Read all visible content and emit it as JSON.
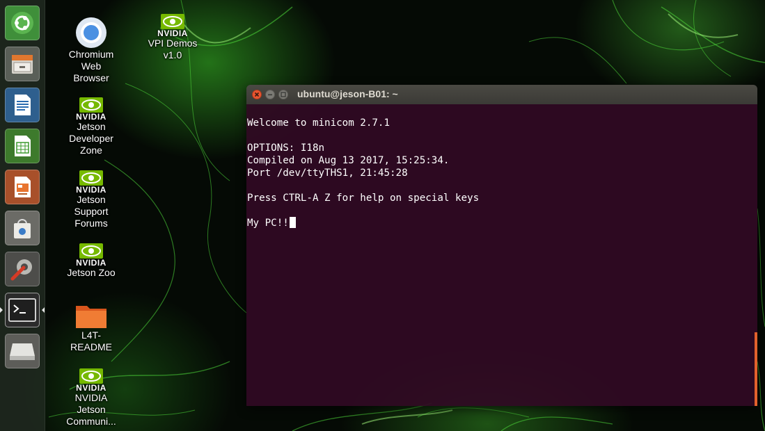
{
  "launcher": {
    "items": [
      {
        "name": "ubuntu-dash",
        "icon": "ubuntu-logo-icon"
      },
      {
        "name": "files",
        "icon": "file-cabinet-icon"
      },
      {
        "name": "libreoffice-writer",
        "icon": "writer-document-icon"
      },
      {
        "name": "libreoffice-calc",
        "icon": "calc-spreadsheet-icon"
      },
      {
        "name": "libreoffice-impress",
        "icon": "impress-presentation-icon"
      },
      {
        "name": "software-center",
        "icon": "shopping-bag-icon"
      },
      {
        "name": "system-settings",
        "icon": "wrench-gear-icon"
      },
      {
        "name": "terminal",
        "icon": "terminal-icon",
        "active": true
      },
      {
        "name": "removable-drive",
        "icon": "drive-icon"
      }
    ]
  },
  "desktop": {
    "chromium": {
      "label_lines": [
        "Chromium",
        "Web",
        "Browser"
      ],
      "icon": "chromium-icon"
    },
    "vpi": {
      "brand": "NVIDIA",
      "label_lines": [
        "VPI Demos",
        "v1.0"
      ],
      "icon": "nvidia-eye-icon"
    },
    "devzone": {
      "brand": "NVIDIA",
      "label_lines": [
        "Jetson",
        "Developer",
        "Zone"
      ],
      "icon": "nvidia-eye-icon"
    },
    "forums": {
      "brand": "NVIDIA",
      "label_lines": [
        "Jetson",
        "Support",
        "Forums"
      ],
      "icon": "nvidia-eye-icon"
    },
    "zoo": {
      "brand": "NVIDIA",
      "label_lines": [
        "Jetson Zoo"
      ],
      "icon": "nvidia-eye-icon"
    },
    "readme": {
      "label_lines": [
        "L4T-",
        "README"
      ],
      "icon": "orange-folder-icon"
    },
    "community": {
      "brand": "NVIDIA",
      "label_lines": [
        "NVIDIA",
        "Jetson",
        "Communi..."
      ],
      "icon": "nvidia-eye-icon"
    }
  },
  "terminal": {
    "title": "ubuntu@jeson-B01: ~",
    "lines": [
      "Welcome to minicom 2.7.1",
      "",
      "OPTIONS: I18n",
      "Compiled on Aug 13 2017, 15:25:34.",
      "Port /dev/ttyTHS1, 21:45:28",
      "",
      "Press CTRL-A Z for help on special keys",
      "",
      "My PC!!"
    ]
  },
  "colors": {
    "terminal_bg": "#300a24",
    "close_button": "#e9542f",
    "scroll_indicator": "#e2612c",
    "nvidia_green": "#76b900"
  }
}
